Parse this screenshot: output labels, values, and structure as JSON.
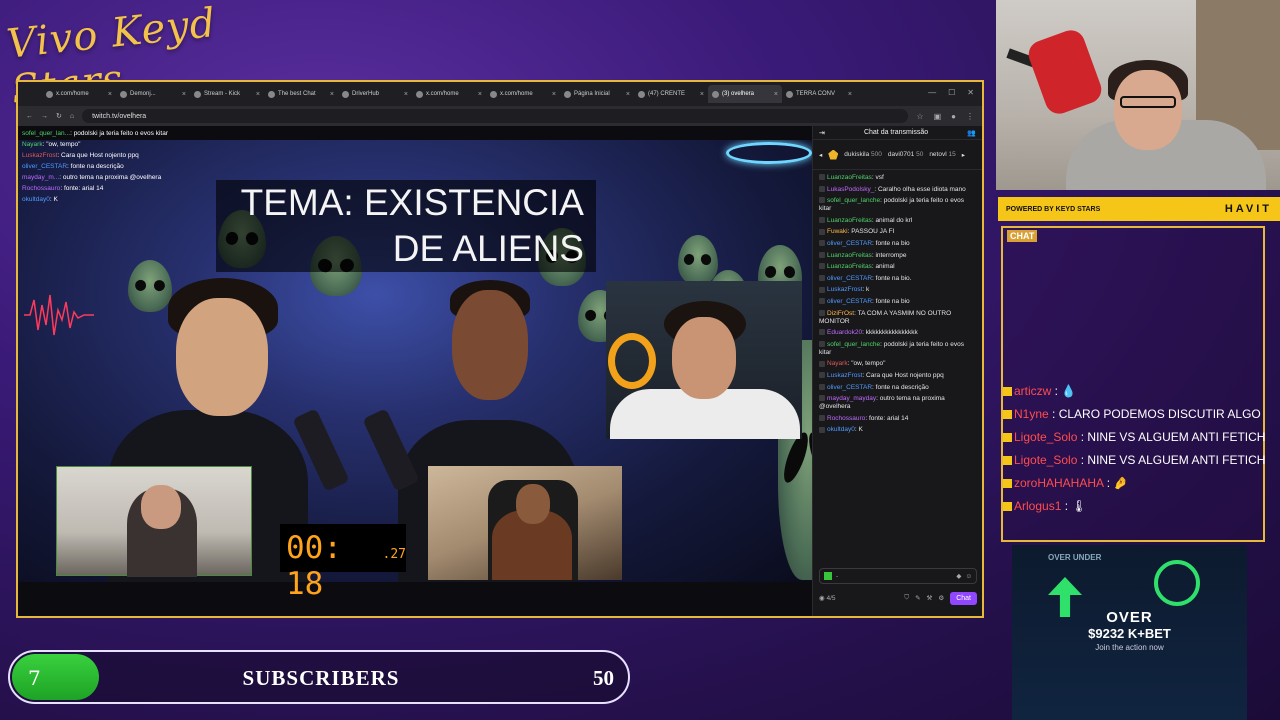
{
  "overlay": {
    "logo_text": "Vivo Keyd Stars"
  },
  "browser": {
    "tabs": [
      {
        "label": "x.com/home"
      },
      {
        "label": "Demonj..."
      },
      {
        "label": "Stream - Kick"
      },
      {
        "label": "The best Chat"
      },
      {
        "label": "DriverHub"
      },
      {
        "label": "x.com/home"
      },
      {
        "label": "x.com/home"
      },
      {
        "label": "Página Inicial"
      },
      {
        "label": "(47) CRENTE"
      },
      {
        "label": "(3) ovelhera"
      },
      {
        "label": "TERRA CONV"
      }
    ],
    "url": "twitch.tv/ovelhera"
  },
  "stream": {
    "title_line1": "TEMA: EXISTENCIA",
    "title_line2": "DE ALIENS",
    "timer_main": "00: 18",
    "timer_frac": ".27",
    "overlay_chat": [
      {
        "user": "sofel_quer_lan...",
        "text": "podolski ja teria feito o evos kitar",
        "cls": "u1"
      },
      {
        "user": "Nayark",
        "text": "\"ow, tempo\"",
        "cls": "u1"
      },
      {
        "user": "LuskazFrost",
        "text": "Cara que Host nojento ppq",
        "cls": "u3"
      },
      {
        "user": "oliver_CESTAR",
        "text": "fonte na descrição",
        "cls": "u2"
      },
      {
        "user": "mayday_m...",
        "text": "outro tema na proxima @ovelhera",
        "cls": "u4"
      },
      {
        "user": "Rochossauro",
        "text": "fonte: arial 14",
        "cls": "u4"
      },
      {
        "user": "okultday0",
        "text": "K",
        "cls": "u2"
      }
    ]
  },
  "twitch_chat": {
    "header": "Chat da transmissão",
    "podium": [
      {
        "name": "dukiskila",
        "sub": "500"
      },
      {
        "name": "davi0701",
        "sub": "50"
      },
      {
        "name": "netovl",
        "sub": "15"
      }
    ],
    "messages": [
      {
        "user": "LuanzaoFreitas",
        "text": "vsf",
        "cls": "u1"
      },
      {
        "user": "LukasPodolsky_",
        "text": "Caralho olha esse idiota mano",
        "cls": "u4"
      },
      {
        "user": "sofel_quer_lanche",
        "text": "podolski ja teria feito o evos kitar",
        "cls": "u1"
      },
      {
        "user": "LuanzaoFreitas",
        "text": "animal do krl",
        "cls": "u1"
      },
      {
        "user": "Fuwaki",
        "text": "PASSOU JA FI",
        "cls": "u5"
      },
      {
        "user": "oliver_CESTAR",
        "text": "fonte na bio",
        "cls": "u2"
      },
      {
        "user": "LuanzaoFreitas",
        "text": "interrompe",
        "cls": "u1"
      },
      {
        "user": "LuanzaoFreitas",
        "text": "animal",
        "cls": "u1"
      },
      {
        "user": "oliver_CESTAR",
        "text": "fonte na bio.",
        "cls": "u2"
      },
      {
        "user": "LuskazFrost",
        "text": "k",
        "cls": "u2"
      },
      {
        "user": "oliver_CESTAR",
        "text": "fonte na bio",
        "cls": "u2"
      },
      {
        "user": "DiziFrOst",
        "text": "TA COM A YASMIM NO OUTRO MONITOR",
        "cls": "u5"
      },
      {
        "user": "Eduardok20",
        "text": "kkkkkkkkkkkkkkkk",
        "cls": "u4"
      },
      {
        "user": "sofel_quer_lanche",
        "text": "podolski ja teria feito o evos kitar",
        "cls": "u1"
      },
      {
        "user": "Nayark",
        "text": "\"ow, tempo\"",
        "cls": "u3"
      },
      {
        "user": "LuskazFrost",
        "text": "Cara que Host nojento ppq",
        "cls": "u2"
      },
      {
        "user": "oliver_CESTAR",
        "text": "fonte na descrição",
        "cls": "u2"
      },
      {
        "user": "mayday_mayday",
        "text": "outro tema na proxima @ovelhera",
        "cls": "u4"
      },
      {
        "user": "Rochossauro",
        "text": "fonte: arial 14",
        "cls": "u4"
      },
      {
        "user": "okultday0",
        "text": "K",
        "cls": "u2"
      }
    ],
    "input_placeholder": "-",
    "count": "4/5",
    "send_label": "Chat"
  },
  "sponsor": {
    "powered_by": "POWERED BY",
    "brand1": "KEYD STARS",
    "brand2": "HAVIT"
  },
  "stream_chat": {
    "header": "CHAT",
    "lines": [
      {
        "user": "articzw",
        "text": "💧"
      },
      {
        "user": "N1yne",
        "text": "CLARO PODEMOS DISCUTIR ALGO FODA TIPO PODCAST"
      },
      {
        "user": "Ligote_Solo",
        "text": "NINE VS ALGUEM ANTI FETICHES"
      },
      {
        "user": "Ligote_Solo",
        "text": "NINE VS ALGUEM ANTI FETICHES"
      },
      {
        "user": "zoroHAHAHAHA",
        "text": "🤌"
      },
      {
        "user": "Arlogus1",
        "text": "🌡"
      }
    ]
  },
  "bet_ad": {
    "top": "OVER UNDER",
    "over": "OVER",
    "amount": "$9232 K+BET",
    "join": "Join the action now",
    "accent": "#2fe06b"
  },
  "subscribers": {
    "current": "7",
    "label": "SUBSCRIBERS",
    "goal": "50",
    "progress": 0.14
  }
}
